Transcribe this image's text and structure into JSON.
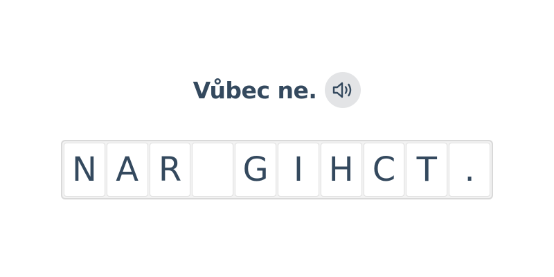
{
  "prompt": {
    "text": "Vůbec ne.",
    "audio_icon": "speaker-icon"
  },
  "tiles": [
    "N",
    "A",
    "R",
    "",
    "G",
    "I",
    "H",
    "C",
    "T",
    "."
  ],
  "colors": {
    "text": "#34495e",
    "speaker_bg": "#e3e4e6",
    "tile_border": "#e0e0e0",
    "frame_bg": "#f2f2f2"
  }
}
